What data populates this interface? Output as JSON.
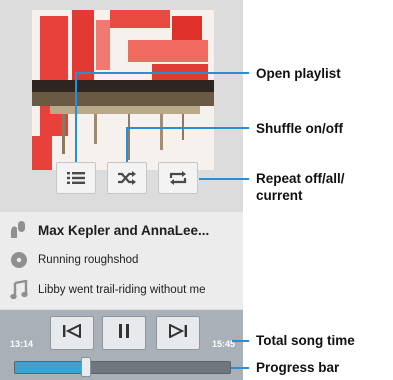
{
  "player": {
    "artist": "Max Kepler and AnnaLee...",
    "album": "Running roughshod",
    "song": "Libby went trail-riding without me",
    "elapsed": "13:14",
    "total": "15:45",
    "progress_fraction": 0.33
  },
  "icons": {
    "playlist": "list-icon",
    "shuffle": "shuffle-icon",
    "repeat": "repeat-icon",
    "artist": "microphone-icon",
    "album": "disc-icon",
    "song": "music-note-icon",
    "previous": "previous-icon",
    "pause": "pause-icon",
    "next": "next-icon"
  },
  "callouts": {
    "open_playlist": "Open playlist",
    "shuffle": "Shuffle on/off",
    "repeat_line1": "Repeat off/all/",
    "repeat_line2": "current",
    "total_time": "Total song time",
    "progress_bar": "Progress bar"
  },
  "colors": {
    "accent": "#2a8fd0",
    "progress": "#3fa0d6",
    "panel": "#a9b0b8"
  }
}
